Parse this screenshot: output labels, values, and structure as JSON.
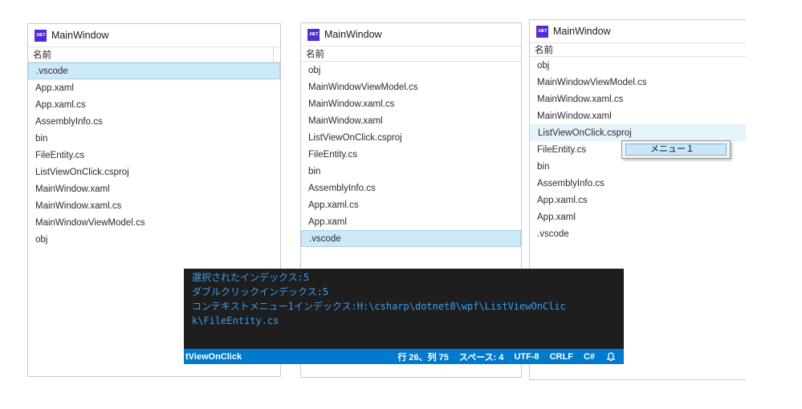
{
  "window1": {
    "title": "MainWindow",
    "column_header": "名前",
    "items": [
      ".vscode",
      "App.xaml",
      "App.xaml.cs",
      "AssemblyInfo.cs",
      "bin",
      "FileEntity.cs",
      "ListViewOnClick.csproj",
      "MainWindow.xaml",
      "MainWindow.xaml.cs",
      "MainWindowViewModel.cs",
      "obj"
    ],
    "selected_index": 0
  },
  "window2": {
    "title": "MainWindow",
    "column_header": "名前",
    "items": [
      "obj",
      "MainWindowViewModel.cs",
      "MainWindow.xaml.cs",
      "MainWindow.xaml",
      "ListViewOnClick.csproj",
      "FileEntity.cs",
      "bin",
      "AssemblyInfo.cs",
      "App.xaml.cs",
      "App.xaml",
      ".vscode"
    ],
    "selected_index": 10
  },
  "window3": {
    "title": "MainWindow",
    "column_header": "名前",
    "items": [
      "obj",
      "MainWindowViewModel.cs",
      "MainWindow.xaml.cs",
      "MainWindow.xaml",
      "ListViewOnClick.csproj",
      "FileEntity.cs",
      "bin",
      "AssemblyInfo.cs",
      "App.xaml.cs",
      "App.xaml",
      ".vscode"
    ],
    "hover_index": 4
  },
  "context_menu": {
    "item": "メニュー１"
  },
  "app_icon_text": ".NET",
  "terminal": {
    "lines": [
      "選択されたインデックス:5",
      "ダブルクリックインデックス:5",
      "コンテキストメニュー1インデックス:H:\\csharp\\dotnet8\\wpf\\ListViewOnClic",
      "k\\FileEntity.cs"
    ]
  },
  "statusbar": {
    "left": "tViewOnClick",
    "position": "行 26、列 75",
    "spaces": "スペース: 4",
    "encoding": "UTF-8",
    "eol": "CRLF",
    "language": "C#"
  },
  "colors": {
    "selection": "#cde8f7",
    "statusbar": "#007acc",
    "terminal_bg": "#1e1e1e",
    "terminal_text": "#3b9cf0",
    "net_icon": "#512bd4"
  }
}
